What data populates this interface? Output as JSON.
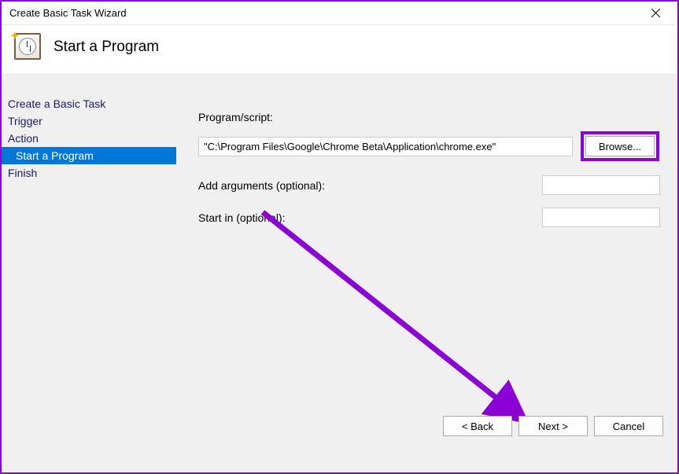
{
  "window": {
    "title": "Create Basic Task Wizard"
  },
  "header": {
    "title": "Start a Program"
  },
  "sidebar": {
    "items": [
      {
        "label": "Create a Basic Task",
        "sub": false,
        "selected": false
      },
      {
        "label": "Trigger",
        "sub": false,
        "selected": false
      },
      {
        "label": "Action",
        "sub": false,
        "selected": false
      },
      {
        "label": "Start a Program",
        "sub": true,
        "selected": true
      },
      {
        "label": "Finish",
        "sub": false,
        "selected": false
      }
    ]
  },
  "form": {
    "program_label": "Program/script:",
    "program_value": "\"C:\\Program Files\\Google\\Chrome Beta\\Application\\chrome.exe\"",
    "browse_label": "Browse...",
    "arguments_label": "Add arguments (optional):",
    "arguments_value": "",
    "startin_label": "Start in (optional):",
    "startin_value": ""
  },
  "footer": {
    "back": "< Back",
    "next": "Next >",
    "cancel": "Cancel"
  },
  "annotation": {
    "highlight_color": "#8b00d4"
  }
}
